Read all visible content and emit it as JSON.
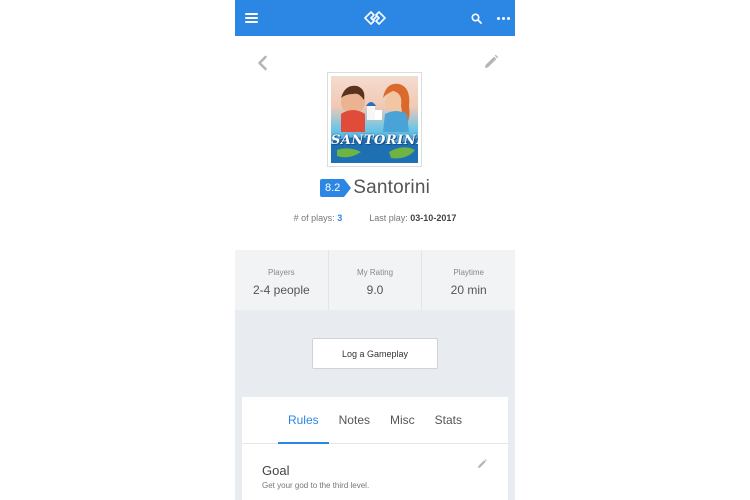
{
  "app": {
    "top_bar": {
      "accent_color": "#2b87e3",
      "icons": [
        "menu-icon",
        "logo-icon",
        "search-icon",
        "more-icon"
      ]
    },
    "game": {
      "cover_text": "SANTORINI",
      "name": "Santorini",
      "rating": "8.2",
      "plays_label": "# of plays:",
      "plays_value": "3",
      "last_play_label": "Last play:",
      "last_play_value": "03-10-2017"
    },
    "stats": [
      {
        "label": "Players",
        "value": "2-4 people"
      },
      {
        "label": "My Rating",
        "value": "9.0"
      },
      {
        "label": "Playtime",
        "value": "20 min"
      }
    ],
    "log_button_label": "Log a Gameplay",
    "tabs": [
      {
        "label": "Rules",
        "active": true
      },
      {
        "label": "Notes",
        "active": false
      },
      {
        "label": "Misc",
        "active": false
      },
      {
        "label": "Stats",
        "active": false
      }
    ],
    "goal": {
      "title": "Goal",
      "text": "Get your god to the third level."
    }
  }
}
